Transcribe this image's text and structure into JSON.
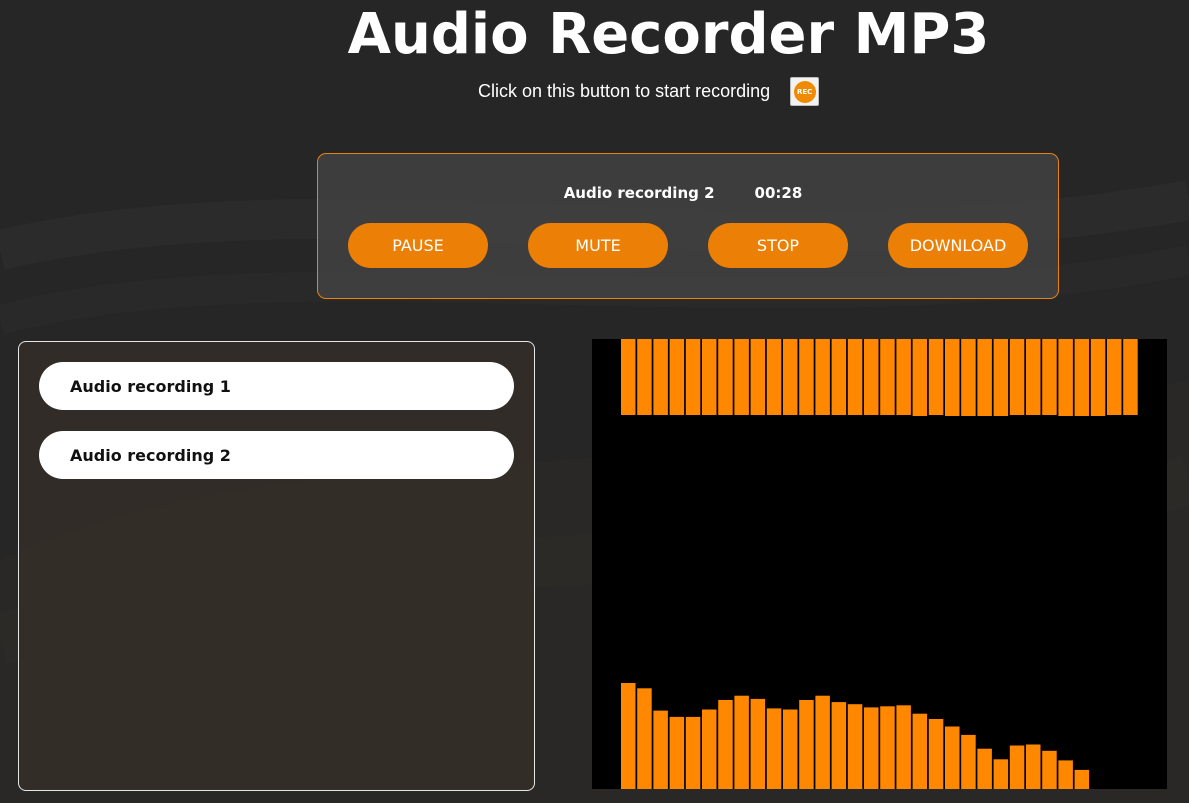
{
  "app": {
    "title": "Audio Recorder MP3",
    "subtitle": "Click on this button to start recording",
    "rec_button_label": "REC"
  },
  "recorder": {
    "current_name": "Audio recording 2",
    "elapsed": "00:28",
    "buttons": {
      "pause": "PAUSE",
      "mute": "MUTE",
      "stop": "STOP",
      "download": "DOWNLOAD"
    }
  },
  "recordings": [
    {
      "label": "Audio recording 1"
    },
    {
      "label": "Audio recording 2"
    }
  ],
  "colors": {
    "accent": "#ec7f06",
    "visualizer_bar": "#ff8800",
    "background": "#262626"
  },
  "visualizer": {
    "top_levels": [
      0.76,
      0.76,
      0.76,
      0.76,
      0.76,
      0.76,
      0.76,
      0.76,
      0.76,
      0.76,
      0.76,
      0.76,
      0.76,
      0.76,
      0.76,
      0.76,
      0.76,
      0.76,
      0.77,
      0.76,
      0.77,
      0.77,
      0.77,
      0.77,
      0.76,
      0.76,
      0.76,
      0.77,
      0.77,
      0.77,
      0.76,
      0.76
    ],
    "bottom_levels": [
      1.0,
      0.95,
      0.74,
      0.68,
      0.68,
      0.75,
      0.84,
      0.88,
      0.85,
      0.76,
      0.75,
      0.84,
      0.88,
      0.82,
      0.8,
      0.77,
      0.78,
      0.79,
      0.71,
      0.66,
      0.59,
      0.51,
      0.38,
      0.28,
      0.41,
      0.42,
      0.36,
      0.27,
      0.18
    ]
  }
}
